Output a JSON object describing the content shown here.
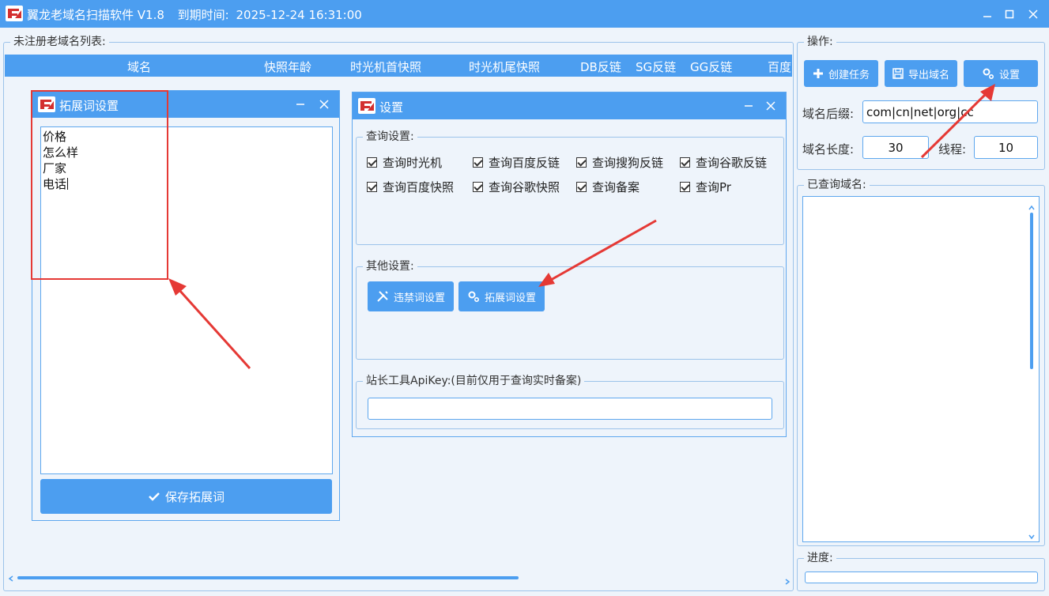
{
  "window": {
    "title": "翼龙老域名扫描软件 V1.8",
    "expiry_label": "到期时间:",
    "expiry_value": "2025-12-24 16:31:00"
  },
  "domain_list": {
    "group_title": "未注册老域名列表:",
    "columns": [
      "域名",
      "快照年龄",
      "时光机首快照",
      "时光机尾快照",
      "DB反链",
      "SG反链",
      "GG反链",
      "百度"
    ]
  },
  "ext_dialog": {
    "title": "拓展词设置",
    "words": [
      "价格",
      "怎么样",
      "厂家",
      "电话"
    ],
    "save_label": "保存拓展词"
  },
  "settings_dialog": {
    "title": "设置",
    "query_group": "查询设置:",
    "checks": [
      {
        "label": "查询时光机",
        "checked": true
      },
      {
        "label": "查询百度反链",
        "checked": true
      },
      {
        "label": "查询搜狗反链",
        "checked": true
      },
      {
        "label": "查询谷歌反链",
        "checked": true
      },
      {
        "label": "查询百度快照",
        "checked": true
      },
      {
        "label": "查询谷歌快照",
        "checked": true
      },
      {
        "label": "查询备案",
        "checked": true
      },
      {
        "label": "查询Pr",
        "checked": true
      }
    ],
    "other_group": "其他设置:",
    "banned_words_label": "违禁词设置",
    "ext_words_label": "拓展词设置",
    "apikey_group": "站长工具ApiKey:(目前仅用于查询实时备案)",
    "apikey_value": ""
  },
  "operations": {
    "group_title": "操作:",
    "create_task_label": "创建任务",
    "export_label": "导出域名",
    "settings_label": "设置",
    "suffix_label": "域名后缀:",
    "suffix_value": "com|cn|net|org|cc",
    "length_label": "域名长度:",
    "length_value": "30",
    "threads_label": "线程:",
    "threads_value": "10"
  },
  "queried": {
    "group_title": "已查询域名:"
  },
  "progress": {
    "group_title": "进度:",
    "value": 0
  },
  "colors": {
    "accent": "#4c9ef0",
    "background": "#eef4fb",
    "annotation": "#e53935"
  }
}
